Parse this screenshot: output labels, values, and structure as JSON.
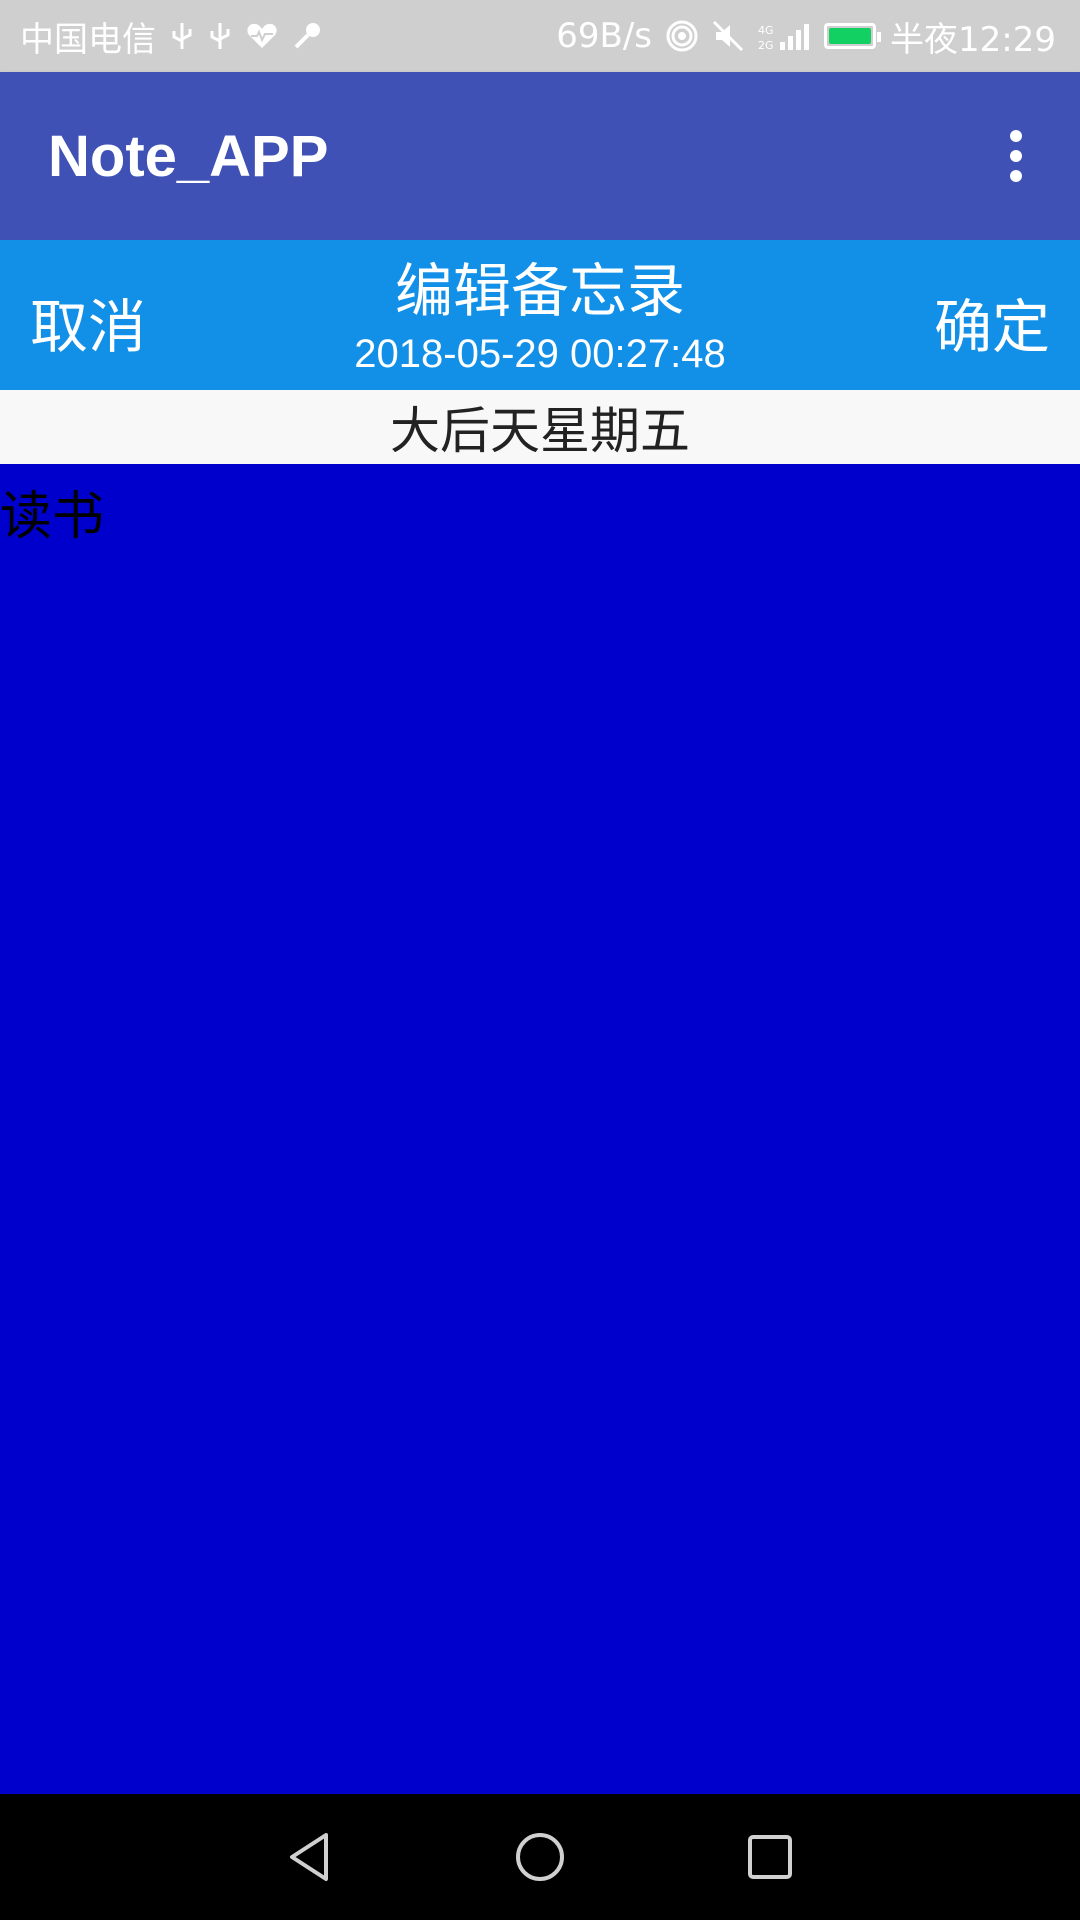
{
  "status_bar": {
    "carrier": "中国电信",
    "speed": "69B/s",
    "time": "半夜12:29",
    "icons": [
      "usb-icon",
      "usb-icon",
      "heart-rate-icon",
      "key-icon",
      "hotspot-icon",
      "mute-icon",
      "signal-icon",
      "battery-icon"
    ],
    "battery_color": "#12d162"
  },
  "app_bar": {
    "title": "Note_APP",
    "color": "#3f51b5"
  },
  "edit_bar": {
    "cancel_label": "取消",
    "title": "编辑备忘录",
    "timestamp": "2018-05-29 00:27:48",
    "confirm_label": "确定",
    "color": "#1290e8"
  },
  "note": {
    "subject": "大后天星期五",
    "content": "读书",
    "content_bg": "#0000cc"
  },
  "nav_bar": {
    "buttons": [
      "back-icon",
      "home-icon",
      "recents-icon"
    ]
  }
}
